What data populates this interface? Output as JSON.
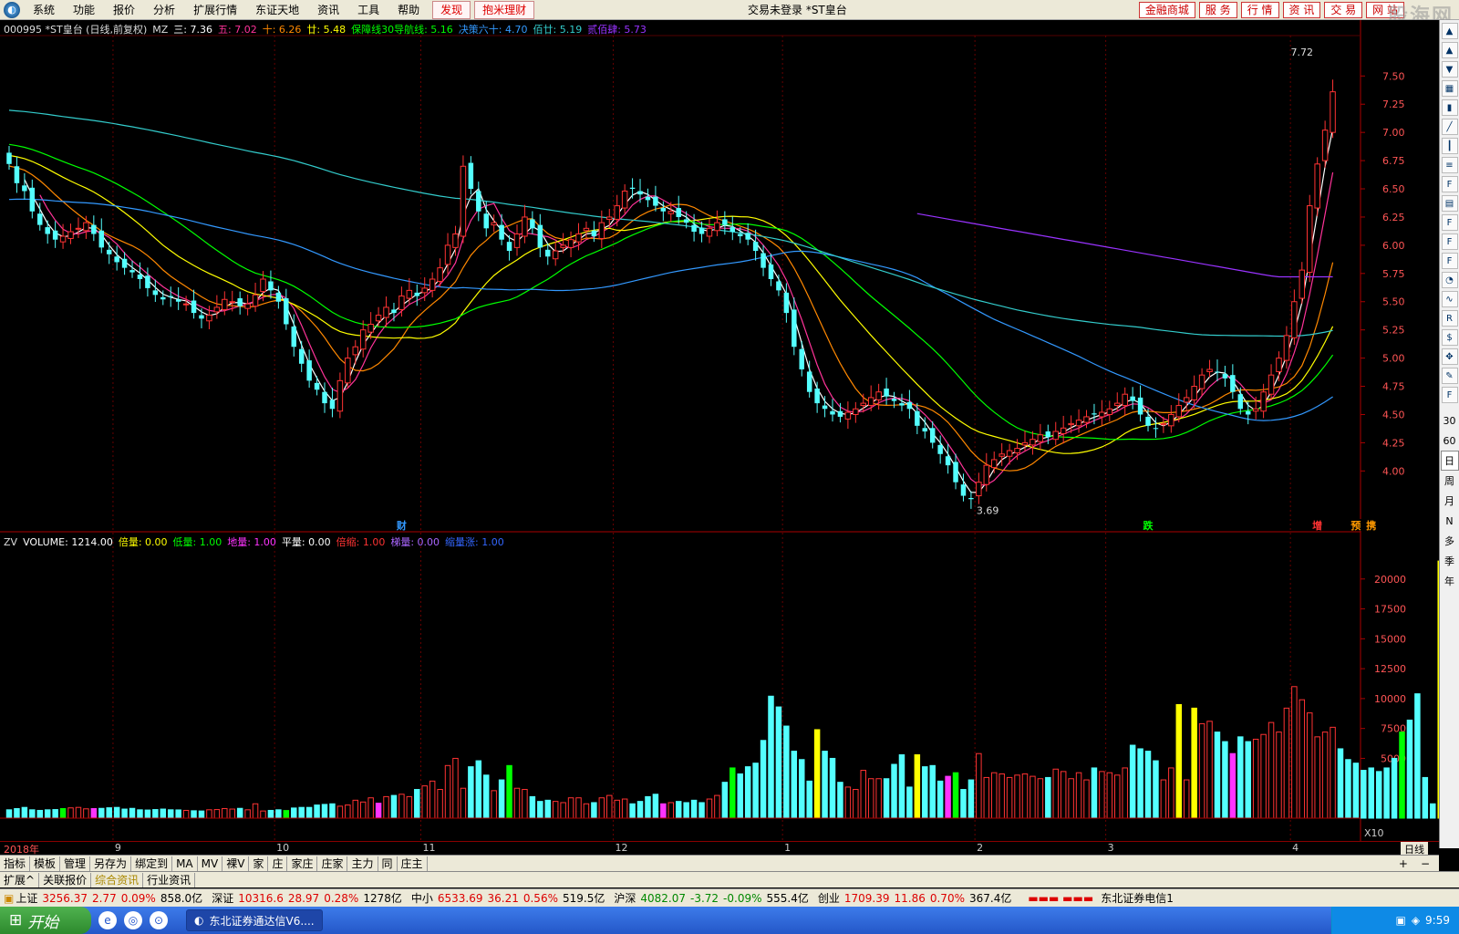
{
  "menu": {
    "items": [
      "系统",
      "功能",
      "报价",
      "分析",
      "扩展行情",
      "东证天地",
      "资讯",
      "工具",
      "帮助"
    ],
    "highlight": [
      "发现",
      "抱米理财"
    ],
    "title": "交易未登录  *ST皇台",
    "right_buttons": [
      "金融商城",
      "服 务",
      "行 情",
      "资 讯",
      "交 易",
      "网 站"
    ],
    "watermark": "股海网"
  },
  "header": {
    "stock": "000995 *ST皇台 (日线,前复权)",
    "indicator": "MZ",
    "ma_items": [
      {
        "label": "三: 7.36",
        "color": "#ffffff"
      },
      {
        "label": "五: 7.02",
        "color": "#ff3399"
      },
      {
        "label": "十: 6.26",
        "color": "#ff8800"
      },
      {
        "label": "廿: 5.48",
        "color": "#ffff00"
      },
      {
        "label": "保障线30导航线: 5.16",
        "color": "#00ff00"
      },
      {
        "label": "决策六十: 4.70",
        "color": "#3399ff"
      },
      {
        "label": "佰廿: 5.19",
        "color": "#33cccc"
      },
      {
        "label": "贰佰肆: 5.73",
        "color": "#9933ff"
      }
    ]
  },
  "volume_header": {
    "name": "ZV",
    "items": [
      {
        "label": "VOLUME: 1214.00",
        "color": "#ffffff"
      },
      {
        "label": "倍量: 0.00",
        "color": "#ffff00"
      },
      {
        "label": "低量: 1.00",
        "color": "#00ff00"
      },
      {
        "label": "地量: 1.00",
        "color": "#ff33ff"
      },
      {
        "label": "平量: 0.00",
        "color": "#ffffff"
      },
      {
        "label": "倍缩: 1.00",
        "color": "#ff3333"
      },
      {
        "label": "梯量: 0.00",
        "color": "#aa66ff"
      },
      {
        "label": "缩量涨: 1.00",
        "color": "#3366ff"
      }
    ]
  },
  "chart_data": {
    "type": "candlestick",
    "price_axis": {
      "ticks": [
        "7.50",
        "7.25",
        "7.00",
        "6.75",
        "6.50",
        "6.25",
        "6.00",
        "5.75",
        "5.50",
        "5.25",
        "5.00",
        "4.75",
        "4.50",
        "4.25",
        "4.00"
      ],
      "range": [
        3.55,
        7.85
      ]
    },
    "volume_axis": {
      "ticks": [
        "20000",
        "17500",
        "15000",
        "12500",
        "10000",
        "7500",
        "5000"
      ],
      "range": [
        0,
        22500
      ],
      "unit_label": "X10"
    },
    "min_label": "3.69",
    "max_label": "7.72",
    "time_labels": [
      {
        "label": "2018年",
        "i": 0
      },
      {
        "label": "9",
        "i": 14
      },
      {
        "label": "10",
        "i": 35
      },
      {
        "label": "11",
        "i": 54
      },
      {
        "label": "12",
        "i": 79
      },
      {
        "label": "1",
        "i": 101
      },
      {
        "label": "2",
        "i": 126
      },
      {
        "label": "3",
        "i": 143
      },
      {
        "label": "4",
        "i": 167
      }
    ],
    "event_markers": [
      {
        "label": "财",
        "i": 51,
        "color": "#3399ff"
      },
      {
        "label": "跌",
        "i": 148,
        "color": "#00ff00"
      },
      {
        "label": "增",
        "i": 170,
        "color": "#ff3333"
      },
      {
        "label": "预",
        "i": 175,
        "color": "#ff9900"
      },
      {
        "label": "携",
        "i": 177,
        "color": "#ff9900"
      }
    ],
    "closes": [
      6.72,
      6.55,
      6.48,
      6.3,
      6.18,
      6.1,
      6.05,
      6.08,
      6.12,
      6.15,
      6.2,
      6.1,
      5.98,
      5.92,
      5.85,
      5.8,
      5.76,
      5.7,
      5.62,
      5.56,
      5.52,
      5.54,
      5.5,
      5.48,
      5.4,
      5.35,
      5.38,
      5.45,
      5.52,
      5.5,
      5.46,
      5.48,
      5.56,
      5.7,
      5.6,
      5.5,
      5.3,
      5.1,
      4.95,
      4.8,
      4.72,
      4.6,
      4.55,
      4.8,
      5.0,
      5.1,
      5.25,
      5.3,
      5.38,
      5.45,
      5.4,
      5.55,
      5.6,
      5.55,
      5.62,
      5.7,
      5.8,
      6.0,
      6.1,
      6.7,
      6.5,
      6.3,
      6.15,
      6.2,
      6.05,
      5.95,
      6.1,
      6.25,
      6.15,
      5.98,
      5.9,
      5.95,
      6.0,
      6.05,
      6.1,
      6.15,
      6.08,
      6.2,
      6.25,
      6.35,
      6.48,
      6.5,
      6.45,
      6.4,
      6.35,
      6.3,
      6.3,
      6.25,
      6.2,
      6.12,
      6.1,
      6.15,
      6.2,
      6.18,
      6.12,
      6.08,
      6.05,
      5.95,
      5.8,
      5.7,
      5.6,
      5.4,
      5.1,
      4.9,
      4.7,
      4.6,
      4.55,
      4.5,
      4.48,
      4.52,
      4.55,
      4.6,
      4.65,
      4.7,
      4.66,
      4.62,
      4.58,
      4.55,
      4.4,
      4.35,
      4.25,
      4.15,
      4.05,
      3.9,
      3.78,
      3.75,
      3.9,
      4.05,
      4.1,
      4.15,
      4.18,
      4.2,
      4.25,
      4.28,
      4.32,
      4.3,
      4.35,
      4.38,
      4.42,
      4.45,
      4.48,
      4.5,
      4.52,
      4.55,
      4.6,
      4.68,
      4.62,
      4.5,
      4.4,
      4.38,
      4.42,
      4.5,
      4.58,
      4.65,
      4.75,
      4.85,
      4.9,
      4.88,
      4.82,
      4.7,
      4.55,
      4.5,
      4.55,
      4.7,
      4.85,
      5.0,
      5.2,
      5.5,
      5.78,
      6.35,
      6.72,
      7.02,
      7.36
    ],
    "volumes": [
      700,
      800,
      900,
      700,
      650,
      700,
      720,
      800,
      860,
      900,
      780,
      800,
      820,
      870,
      900,
      760,
      820,
      700,
      680,
      720,
      760,
      700,
      690,
      650,
      620,
      600,
      700,
      720,
      800,
      760,
      820,
      700,
      1200,
      600,
      650,
      700,
      640,
      850,
      900,
      900,
      1100,
      1150,
      1200,
      1000,
      1100,
      1500,
      1350,
      1700,
      1250,
      1800,
      1900,
      2000,
      1800,
      2400,
      2700,
      3100,
      2400,
      4400,
      5000,
      2500,
      4300,
      4800,
      3600,
      2300,
      3200,
      4400,
      2500,
      2400,
      1800,
      1400,
      1500,
      1400,
      1300,
      1700,
      1700,
      1200,
      1300,
      1700,
      1900,
      1500,
      1600,
      1200,
      1400,
      1800,
      2000,
      1200,
      1300,
      1400,
      1300,
      1500,
      1300,
      1600,
      1900,
      3000,
      4200,
      3700,
      4300,
      4600,
      6500,
      10200,
      9300,
      7700,
      5600,
      4900,
      3100,
      7400,
      5600,
      5000,
      3000,
      2600,
      2400,
      4000,
      3300,
      3300,
      3300,
      4500,
      5300,
      2600,
      5300,
      4300,
      4400,
      3100,
      3500,
      3800,
      2400,
      3200,
      5400,
      3400,
      3800,
      3700,
      3400,
      3600,
      3700,
      3500,
      3300,
      3400,
      4100,
      3900,
      3300,
      3800,
      3200,
      4200,
      3900,
      3800,
      3600,
      4200,
      6100,
      5800,
      5600,
      4800,
      3200,
      4200,
      9500,
      3200,
      9200,
      7900,
      8100,
      7200,
      6400,
      5400,
      6800,
      6400,
      6600,
      7000,
      8000,
      7200,
      9200,
      11000,
      9900,
      8800,
      6800,
      7200,
      7600,
      5800,
      4900,
      4600,
      4000,
      4200,
      3900,
      4200,
      5000,
      7200,
      8200,
      10400,
      3400,
      1200,
      21500,
      3300,
      700,
      650,
      1214
    ],
    "series": [
      {
        "name": "三",
        "color": "#ffffff"
      },
      {
        "name": "五",
        "color": "#ff3399"
      },
      {
        "name": "十",
        "color": "#ff8800"
      },
      {
        "name": "廿",
        "color": "#ffff00"
      },
      {
        "name": "保障线30导航线",
        "color": "#00ff00"
      },
      {
        "name": "决策六十",
        "color": "#3399ff"
      },
      {
        "name": "佰廿",
        "color": "#33cccc"
      },
      {
        "name": "贰佰肆",
        "color": "#9933ff"
      }
    ],
    "colors": {
      "up": "#ff3333",
      "down": "#54ffff",
      "vol_highlight": "#ffff00",
      "vol_low": "#00ff00",
      "vol_ground": "#ff33ff",
      "vol_shrink_up": "#3333ff"
    }
  },
  "right_toolbar": {
    "icons": [
      "up-arrow-icon",
      "up-arrow-icon",
      "down-arrow-icon",
      "grid-icon",
      "bar-chart-icon",
      "line-chart-icon",
      "candle-icon",
      "list-icon",
      "f10-icon",
      "doc-icon",
      "f1-icon",
      "f2-icon",
      "f3-icon",
      "pie-icon",
      "wave-icon",
      "rsi-icon",
      "money-icon",
      "move-icon",
      "pencil-icon",
      "f5-icon",
      "f6-icon",
      "f7-icon",
      "f8-icon",
      "f9-icon"
    ],
    "periods": [
      "30",
      "60",
      "日",
      "周",
      "月",
      "N",
      "多",
      "季",
      "年"
    ],
    "selected": "日",
    "bottom_label": "日线"
  },
  "tabs_row1": [
    "指标",
    "模板",
    "管理",
    "另存为",
    "绑定到",
    "MA",
    "MV",
    "裸V",
    "家",
    "庄",
    "家庄",
    "庄家",
    "主力",
    "同",
    "庄主"
  ],
  "tabs_row2": [
    "扩展^",
    "关联报价",
    "综合资讯",
    "行业资讯"
  ],
  "tabs_row2_active": "综合资讯",
  "tabs_row1_right": [
    "+",
    "−"
  ],
  "status": {
    "indices": [
      {
        "name": "上证",
        "value": "3256.37",
        "change": "2.77",
        "pct": "0.09%",
        "amount": "858.0亿",
        "dir": "up"
      },
      {
        "name": "深证",
        "value": "10316.6",
        "change": "28.97",
        "pct": "0.28%",
        "amount": "1278亿",
        "dir": "up"
      },
      {
        "name": "中小",
        "value": "6533.69",
        "change": "36.21",
        "pct": "0.56%",
        "amount": "519.5亿",
        "dir": "up"
      },
      {
        "name": "沪深",
        "value": "4082.07",
        "change": "-3.72",
        "pct": "-0.09%",
        "amount": "555.4亿",
        "dir": "down"
      },
      {
        "name": "创业",
        "value": "1709.39",
        "change": "11.86",
        "pct": "0.70%",
        "amount": "367.4亿",
        "dir": "up"
      }
    ],
    "broker": "东北证券电信1"
  },
  "taskbar": {
    "start": "开始",
    "app": "东北证券通达信V6....",
    "time": "9:59"
  }
}
